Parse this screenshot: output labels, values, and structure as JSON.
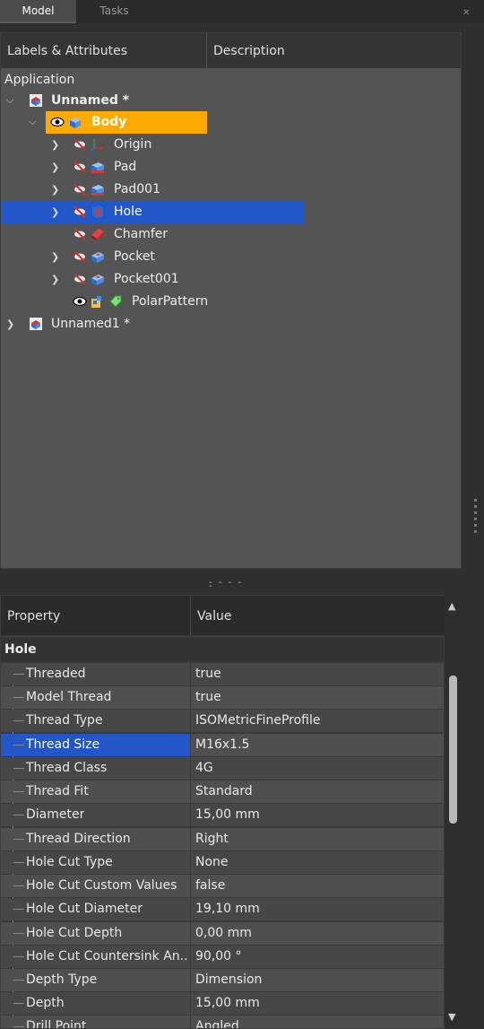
{
  "tabs": [
    {
      "label": "Model",
      "active": true
    },
    {
      "label": "Tasks",
      "active": false
    }
  ],
  "tree": {
    "headers": {
      "labels": "Labels & Attributes",
      "description": "Description"
    },
    "root": "Application",
    "items": [
      {
        "label": "Unnamed *",
        "icon": "document-icon"
      },
      {
        "label": "Body",
        "icon": "body-icon"
      },
      {
        "label": "Origin",
        "icon": "origin-icon"
      },
      {
        "label": "Pad",
        "icon": "pad-icon"
      },
      {
        "label": "Pad001",
        "icon": "pad-icon"
      },
      {
        "label": "Hole",
        "icon": "hole-icon"
      },
      {
        "label": "Chamfer",
        "icon": "chamfer-icon"
      },
      {
        "label": "Pocket",
        "icon": "pocket-icon"
      },
      {
        "label": "Pocket001",
        "icon": "pocket-icon"
      },
      {
        "label": "PolarPattern",
        "icon": "polar-pattern-icon"
      },
      {
        "label": "Unnamed1 *",
        "icon": "document-icon"
      }
    ]
  },
  "properties": {
    "headers": {
      "property": "Property",
      "value": "Value"
    },
    "group": "Hole",
    "rows": [
      {
        "name": "Threaded",
        "value": "true"
      },
      {
        "name": "Model Thread",
        "value": "true"
      },
      {
        "name": "Thread Type",
        "value": "ISOMetricFineProfile"
      },
      {
        "name": "Thread Size",
        "value": "M16x1.5"
      },
      {
        "name": "Thread Class",
        "value": "4G"
      },
      {
        "name": "Thread Fit",
        "value": "Standard"
      },
      {
        "name": "Diameter",
        "value": "15,00 mm"
      },
      {
        "name": "Thread Direction",
        "value": "Right"
      },
      {
        "name": "Hole Cut Type",
        "value": "None"
      },
      {
        "name": "Hole Cut Custom Values",
        "value": "false"
      },
      {
        "name": "Hole Cut Diameter",
        "value": "19,10 mm"
      },
      {
        "name": "Hole Cut Depth",
        "value": "0,00 mm"
      },
      {
        "name": "Hole Cut Countersink An...",
        "value": "90,00 °"
      },
      {
        "name": "Depth Type",
        "value": "Dimension"
      },
      {
        "name": "Depth",
        "value": "15,00 mm"
      },
      {
        "name": "Drill Point",
        "value": "Angled"
      }
    ]
  },
  "colors": {
    "body_highlight": "#ffaa00",
    "selection": "#2356c8"
  }
}
